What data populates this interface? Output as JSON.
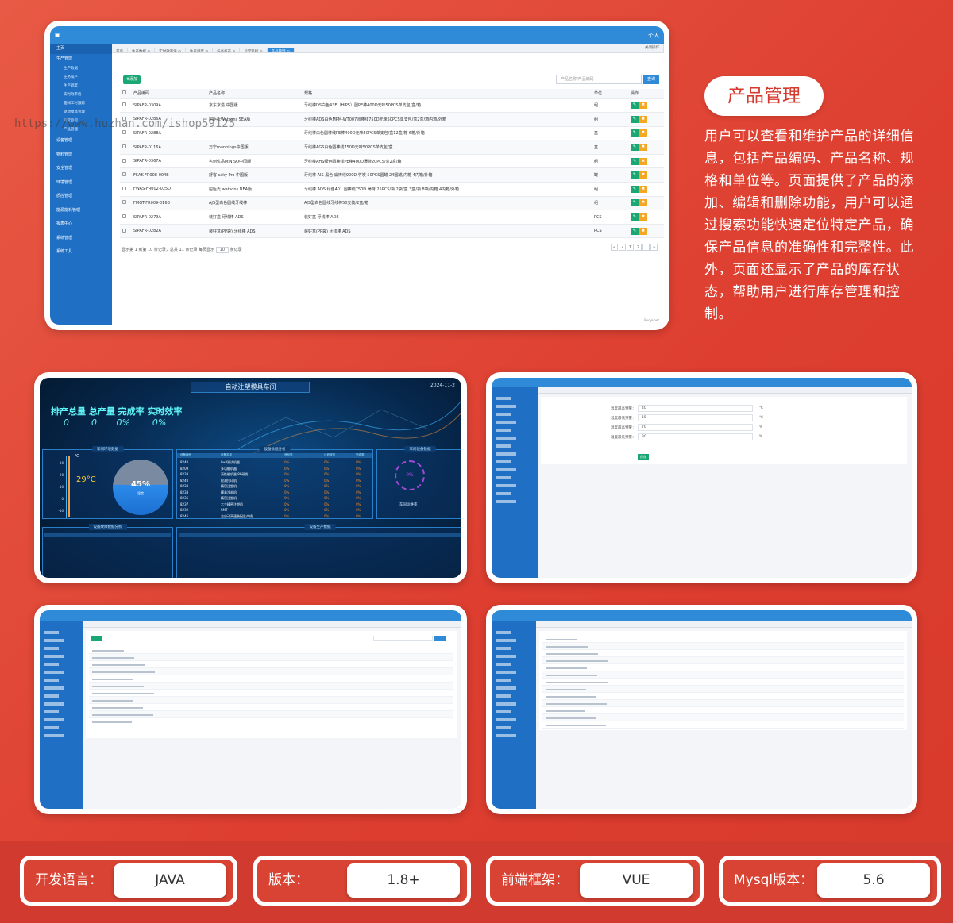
{
  "watermark": "https://www.huzhan.com/ishop59125",
  "feature": {
    "title": "产品管理",
    "description": "用户可以查看和维护产品的详细信息，包括产品编码、产品名称、规格和单位等。页面提供了产品的添加、编辑和删除功能，用户可以通过搜索功能快速定位特定产品，确保产品信息的准确性和完整性。此外，页面还显示了产品的库存状态，帮助用户进行库存管理和控制。"
  },
  "main_screen": {
    "user": "个人",
    "sidebar": {
      "home": "主页",
      "group_production": "生产管理",
      "production_sub": [
        "生产数据",
        "任务排产",
        "生产调度",
        "实时效率值",
        "脑阀工时跟踪",
        "驱动模具管理",
        "异常监控",
        "产品管理"
      ],
      "groups": [
        "设备管理",
        "物料管理",
        "安全管理",
        "环境管理",
        "质控管理",
        "能源能耗管理",
        "报表中心",
        "系统管理",
        "系统工具"
      ]
    },
    "tabs": [
      "首页",
      "生产数据 ⊙",
      "实时效率值 ⊙",
      "生产调度 ⊙",
      "任务排产 ⊙",
      "异常监控 ⊙",
      "产品管理 ⊙"
    ],
    "tabs_right": "关闭操作",
    "add_label": "✚添加",
    "search_placeholder": "产品名称/产品编码",
    "search_label": "查询",
    "columns": [
      "产品编码",
      "产品名称",
      "规格",
      "单位",
      "操作"
    ],
    "rows": [
      {
        "code": "SIPAFR-0309A",
        "name": "京东京造 中国版",
        "spec": "牙线棒DS白色43E（HIPS）圆PE棒400D无味50PCS单支包/盒/箱",
        "unit": "组"
      },
      {
        "code": "SIPAFR-0286A",
        "name": "屈臣氏Watsons SEA版",
        "spec": "牙线棒ADS白色MPM-WT007圆棒线750D无味50PCS单支包/盒2盒/箱内箱/外箱",
        "unit": "组"
      },
      {
        "code": "SIPAFR-0288A",
        "name": "",
        "spec": "牙线棒白色圆棒线PE棒400D无味50PCS单支包/盒12盒/箱 6箱/外箱",
        "unit": "盒"
      },
      {
        "code": "SIPAFR-0116A",
        "name": "万宁mannings中国版",
        "spec": "牙线棒AGS白色圆棒线750D无味50PCS单支包/盒",
        "unit": "盒"
      },
      {
        "code": "SIPAFR-0367A",
        "name": "名创优品MINISO中国版",
        "spec": "牙线棒AHS绿色圆棒线PE棒400D薄荷20PCS/盒2盒/箱",
        "unit": "组"
      },
      {
        "code": "FSAK-FR008-004B",
        "name": "舒客 saky Pro 中国版",
        "spec": "牙线棒 AIS 黑色 扁棒线900D 竹炭 50PCS圆罐 24圆罐/内箱 4内箱/外箱",
        "unit": "罐"
      },
      {
        "code": "FWAS-FR002-025D",
        "name": "屈臣氏 watsons NEA版",
        "spec": "牙线棒 ADS 绿色401 圆棒线750D 薄荷 25PCS/袋 2袋/盒 3盒/袋 8袋/内箱 4内箱/外箱",
        "unit": "组"
      },
      {
        "code": "FMGT-FR009-016B",
        "name": "AJS型白色圆线牙线棒",
        "spec": "AJS型白色圆线牙线棒50支装/2盒/箱",
        "unit": "组"
      },
      {
        "code": "SIPAFR-0279A",
        "name": "装好盒 牙线棒 ADS",
        "spec": "装好盒 牙线棒 ADS",
        "unit": "PCS"
      },
      {
        "code": "SIPAFR-0282A",
        "name": "装好盒(PP袋) 牙线棒 ADS",
        "spec": "装好盒(PP袋) 牙线棒 ADS",
        "unit": "PCS"
      }
    ],
    "edit_icon": "✎",
    "delete_icon": "✖",
    "pagination_text": "显示第 1 到第 10 条记录，总共 11 条记录 每页显示",
    "page_size": "10",
    "page_size_suffix": "条记录",
    "pages": [
      "«",
      "‹",
      "1",
      "2",
      "›",
      "»"
    ],
    "footer": "Ruoyi·net"
  },
  "dashboard": {
    "title": "自动注塑模具车间",
    "time": "2024-11-2",
    "kpi_labels": "排产总量  总产量  完成率  实时效率",
    "kpi_values": [
      "0",
      "0",
      "0%",
      "0%"
    ],
    "panel_env": "车间环境数据",
    "temp_unit": "℃",
    "temp_ticks": [
      "30",
      "20",
      "10",
      "0",
      "-10"
    ],
    "temp_value": "29°C",
    "humidity_value": "45%",
    "humidity_label": "湿度",
    "panel_equipment": "设备数据分析",
    "equipment_headers": [
      "设备编号",
      "设备名称",
      "良品率",
      "计划效率",
      "完成率"
    ],
    "equipment": [
      {
        "no": "8240",
        "name": "Lw3测试机器"
      },
      {
        "no": "8209",
        "name": "多功能机器"
      },
      {
        "no": "8233",
        "name": "高性能机器 88研发"
      },
      {
        "no": "8240",
        "name": "检测打印机"
      },
      {
        "no": "8233",
        "name": "精密注塑机"
      },
      {
        "no": "8233",
        "name": "模具冷却机"
      },
      {
        "no": "8235",
        "name": "精密注塑机"
      },
      {
        "no": "8237",
        "name": "六个精密注塑机"
      },
      {
        "no": "8239",
        "name": "SMT"
      },
      {
        "no": "8246",
        "name": "全自动高速装配生产线"
      }
    ],
    "eq_pct": "0%",
    "panel_device": "车间设备数据",
    "device_ring": "0%",
    "device_label": "车间运维率",
    "panel_bottom_left": "设备故障数据分析",
    "panel_bottom_right": "设备生产数据"
  },
  "settings_screen": {
    "fields": [
      "温度最高预警：",
      "温度最低预警：",
      "湿度最高预警：",
      "湿度最低预警："
    ],
    "values": [
      "40",
      "15",
      "70",
      "30"
    ],
    "units": [
      "℃",
      "℃",
      "%",
      "%"
    ],
    "save_label": "保存"
  },
  "specs": [
    {
      "label": "开发语言：",
      "value": "JAVA"
    },
    {
      "label": "版本：",
      "value": "1.8+"
    },
    {
      "label": "前端框架：",
      "value": "VUE"
    },
    {
      "label": "Mysql版本：",
      "value": "5.6"
    }
  ]
}
